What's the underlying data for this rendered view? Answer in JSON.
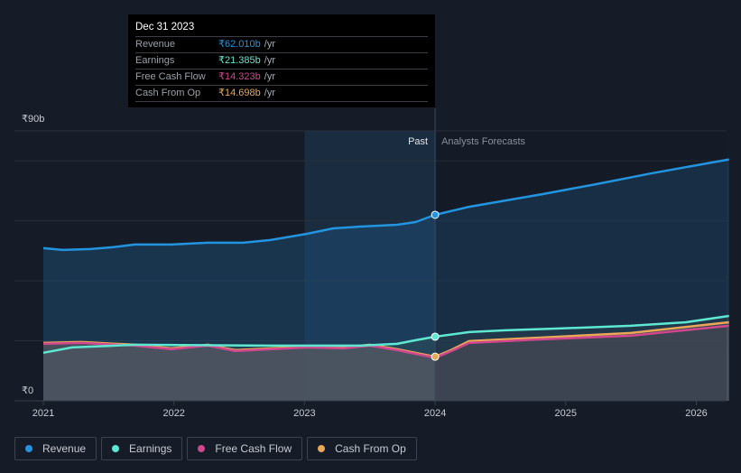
{
  "tooltip": {
    "date": "Dec 31 2023",
    "rows": [
      {
        "label": "Revenue",
        "value": "₹62.010b",
        "unit": "/yr",
        "color": "#2394df"
      },
      {
        "label": "Earnings",
        "value": "₹21.385b",
        "unit": "/yr",
        "color": "#5ee8d2"
      },
      {
        "label": "Free Cash Flow",
        "value": "₹14.323b",
        "unit": "/yr",
        "color": "#d0478d"
      },
      {
        "label": "Cash From Op",
        "value": "₹14.698b",
        "unit": "/yr",
        "color": "#e8a857"
      }
    ]
  },
  "chart_data": {
    "type": "line",
    "ylim": [
      0,
      90
    ],
    "xlim": [
      2020.85,
      2026.25
    ],
    "y_ticks": [
      "₹0",
      "₹90b"
    ],
    "x_ticks": [
      "2021",
      "2022",
      "2023",
      "2024",
      "2025",
      "2026"
    ],
    "divider_year": 2024.0,
    "highlight_start": 2023.0,
    "past_label": "Past",
    "forecast_label": "Analysts Forecasts",
    "series": [
      {
        "name": "Revenue",
        "color": "#2394df",
        "points": [
          [
            2021.0,
            50.9
          ],
          [
            2021.15,
            50.3
          ],
          [
            2021.36,
            50.6
          ],
          [
            2021.53,
            51.2
          ],
          [
            2021.7,
            52.1
          ],
          [
            2021.98,
            52.1
          ],
          [
            2022.26,
            52.7
          ],
          [
            2022.53,
            52.7
          ],
          [
            2022.74,
            53.6
          ],
          [
            2023.02,
            55.7
          ],
          [
            2023.22,
            57.5
          ],
          [
            2023.43,
            58.1
          ],
          [
            2023.71,
            58.7
          ],
          [
            2023.85,
            59.6
          ],
          [
            2024.0,
            62.01
          ],
          [
            2024.26,
            64.7
          ],
          [
            2024.82,
            68.9
          ],
          [
            2025.23,
            72.2
          ],
          [
            2025.65,
            75.8
          ],
          [
            2026.25,
            80.5
          ]
        ]
      },
      {
        "name": "Earnings",
        "color": "#5ee8d2",
        "points": [
          [
            2021.0,
            16.0
          ],
          [
            2021.22,
            17.8
          ],
          [
            2021.7,
            18.7
          ],
          [
            2022.74,
            18.4
          ],
          [
            2023.43,
            18.4
          ],
          [
            2023.71,
            19.0
          ],
          [
            2023.85,
            20.2
          ],
          [
            2024.0,
            21.385
          ],
          [
            2024.26,
            22.9
          ],
          [
            2024.54,
            23.5
          ],
          [
            2024.95,
            24.1
          ],
          [
            2025.5,
            25.0
          ],
          [
            2025.92,
            26.2
          ],
          [
            2026.25,
            28.3
          ]
        ]
      },
      {
        "name": "Free Cash Flow",
        "color": "#d0478d",
        "points": [
          [
            2021.0,
            19.0
          ],
          [
            2021.29,
            19.3
          ],
          [
            2021.7,
            18.4
          ],
          [
            2021.98,
            17.2
          ],
          [
            2022.26,
            18.4
          ],
          [
            2022.47,
            16.6
          ],
          [
            2022.74,
            17.2
          ],
          [
            2023.02,
            17.8
          ],
          [
            2023.3,
            17.5
          ],
          [
            2023.5,
            18.4
          ],
          [
            2023.71,
            16.9
          ],
          [
            2024.0,
            14.323
          ],
          [
            2024.12,
            16.5
          ],
          [
            2024.26,
            19.3
          ],
          [
            2024.82,
            20.5
          ],
          [
            2025.5,
            21.7
          ],
          [
            2026.25,
            25.0
          ]
        ]
      },
      {
        "name": "Cash From Op",
        "color": "#e8a857",
        "points": [
          [
            2021.0,
            19.3
          ],
          [
            2021.29,
            19.6
          ],
          [
            2021.7,
            18.7
          ],
          [
            2021.98,
            17.5
          ],
          [
            2022.26,
            18.7
          ],
          [
            2022.47,
            16.9
          ],
          [
            2022.74,
            17.5
          ],
          [
            2023.02,
            18.1
          ],
          [
            2023.3,
            17.8
          ],
          [
            2023.5,
            18.7
          ],
          [
            2023.71,
            17.2
          ],
          [
            2024.0,
            14.698
          ],
          [
            2024.12,
            16.9
          ],
          [
            2024.26,
            19.9
          ],
          [
            2024.82,
            21.1
          ],
          [
            2025.5,
            22.6
          ],
          [
            2026.25,
            26.2
          ]
        ]
      }
    ]
  },
  "legend": [
    {
      "label": "Revenue",
      "color": "#2394df"
    },
    {
      "label": "Earnings",
      "color": "#5ee8d2"
    },
    {
      "label": "Free Cash Flow",
      "color": "#d0478d"
    },
    {
      "label": "Cash From Op",
      "color": "#e8a857"
    }
  ]
}
